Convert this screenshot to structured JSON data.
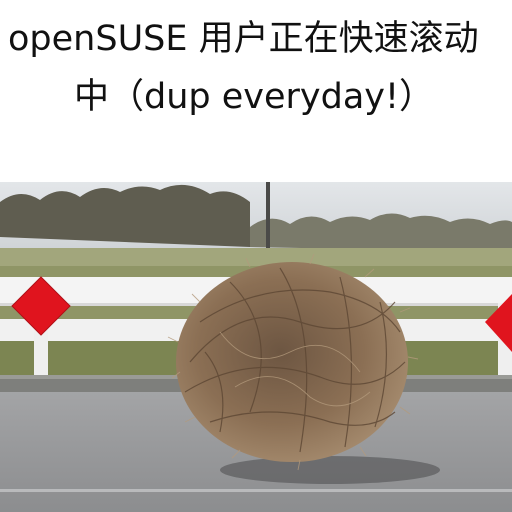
{
  "caption": {
    "line1": "openSUSE 用户正在快速滚动",
    "line2": "中（dup everyday!）"
  },
  "photo": {
    "subject": "tumbleweed-rolling-across-road",
    "colors": {
      "sky": "#d6dade",
      "grass": "#8f9566",
      "road": "#9a9b9d",
      "fence": "#f4f4f4",
      "sign": "#e0141e",
      "tumbleweed": "#8a6e52"
    }
  }
}
